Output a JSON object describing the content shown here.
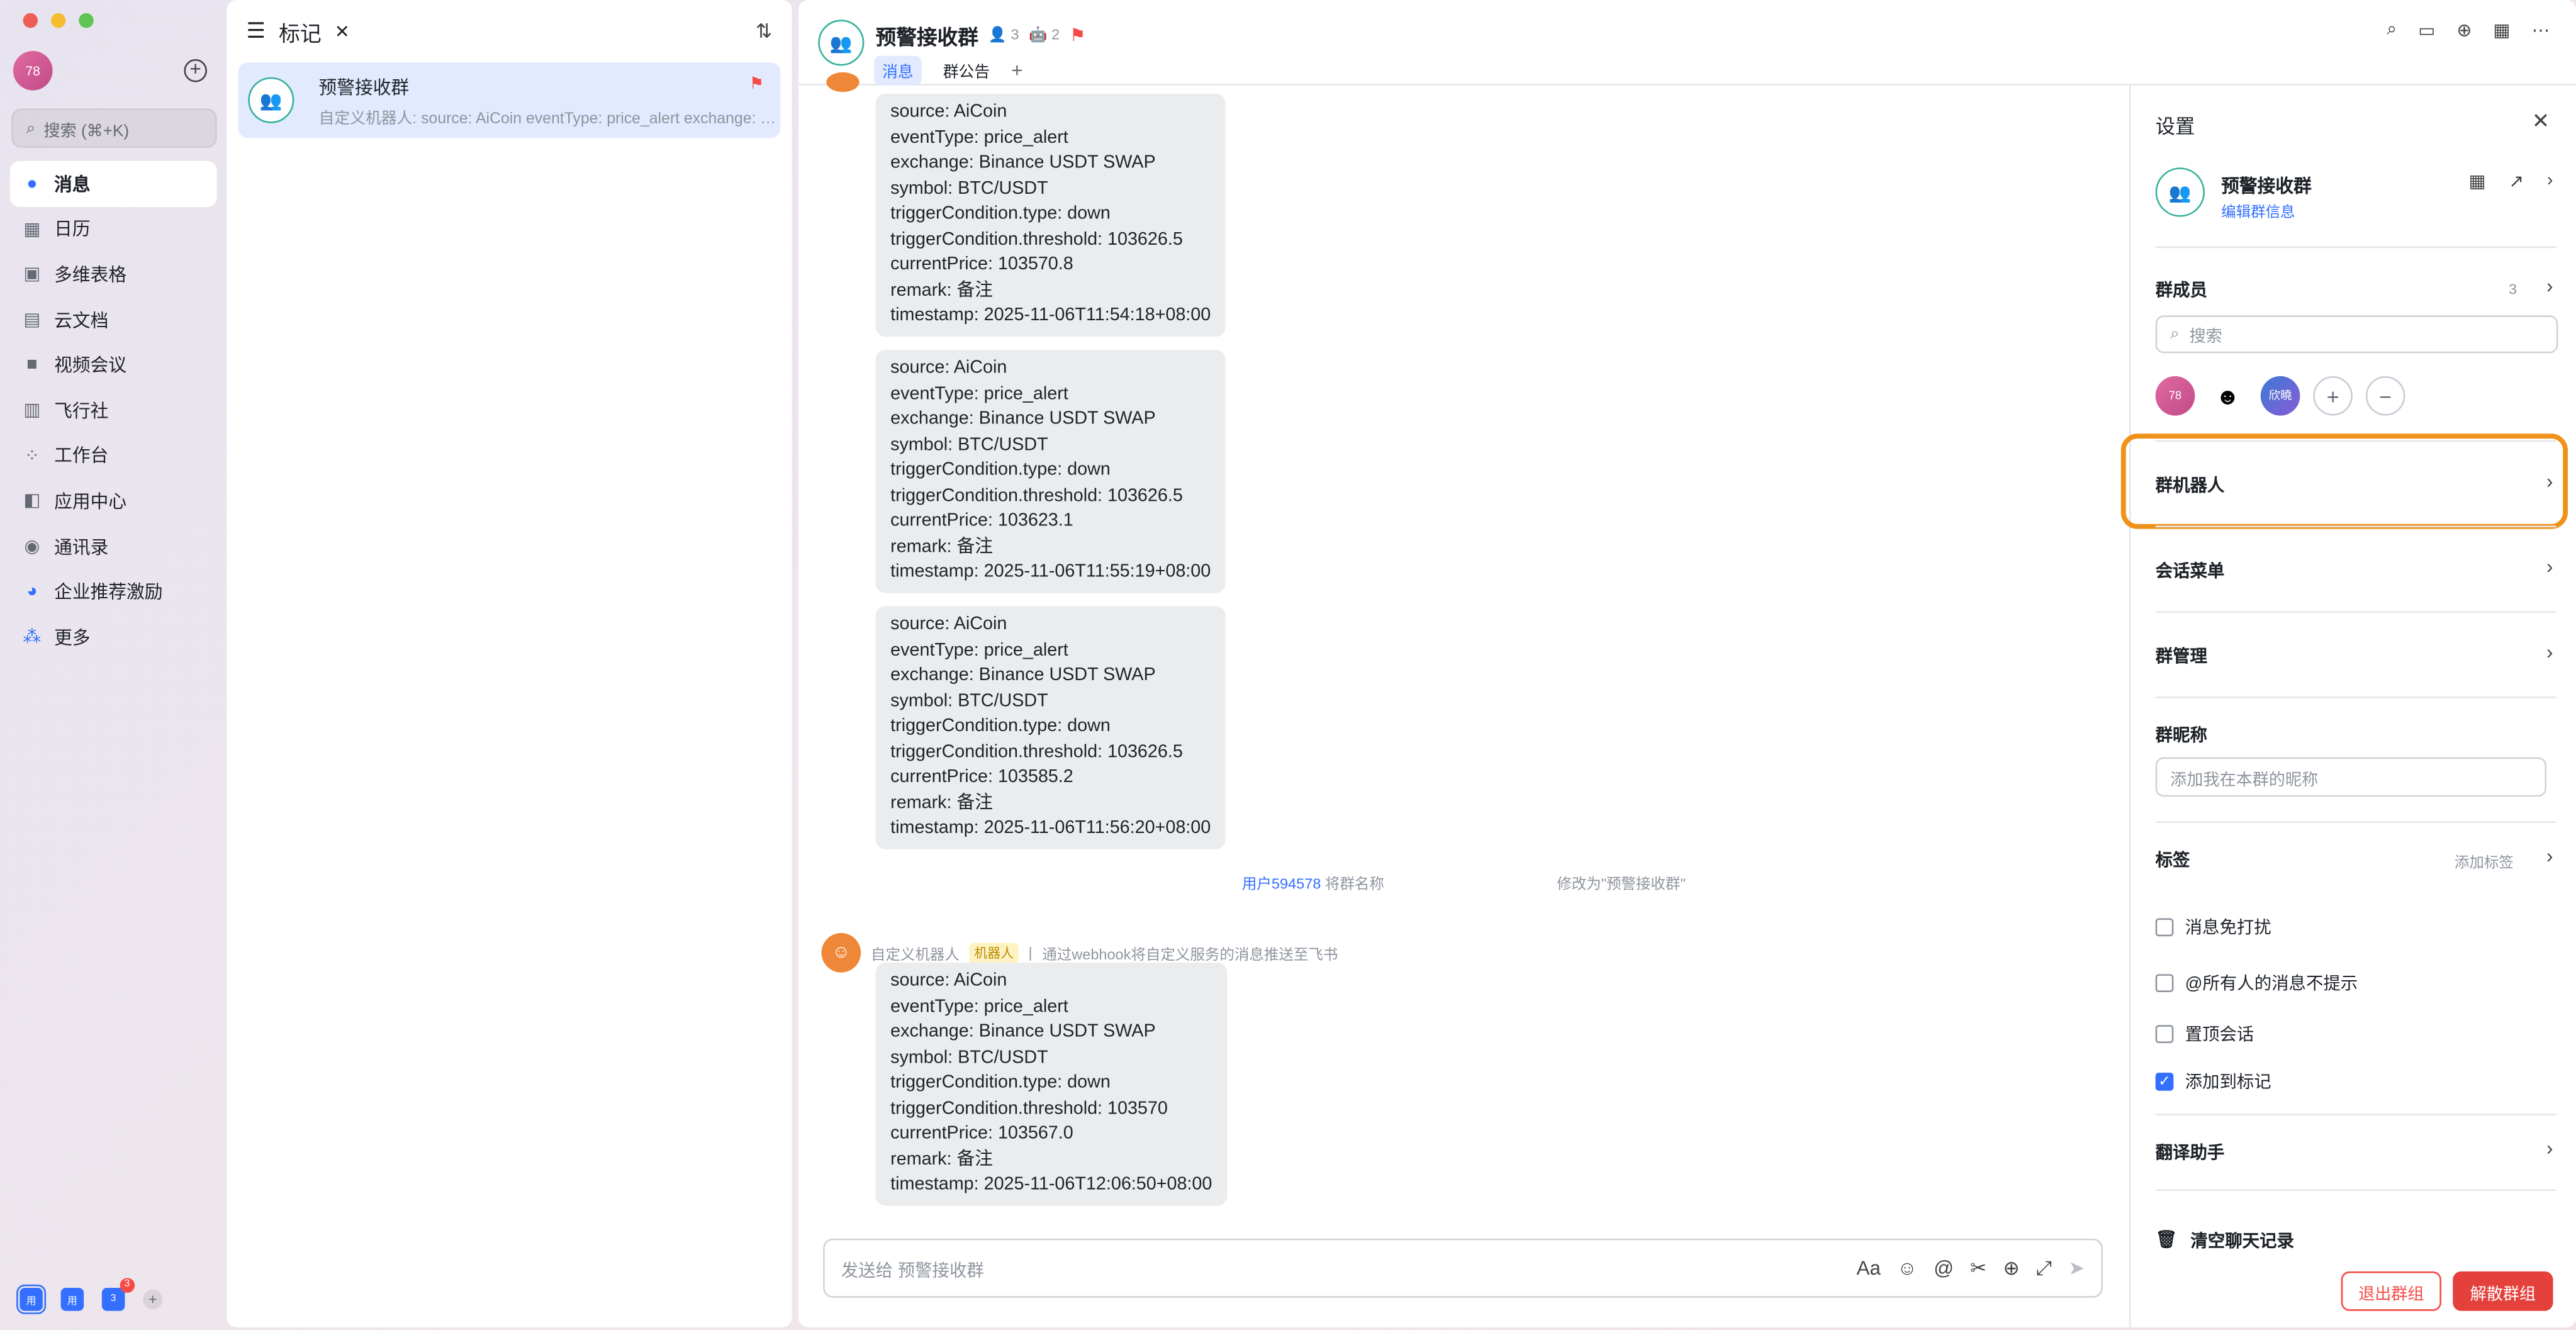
{
  "me": {
    "avatar_text": "78"
  },
  "search": {
    "placeholder": "搜索 (⌘+K)"
  },
  "nav": [
    {
      "label": "消息",
      "icon": "message-icon",
      "color": "#3370ff"
    },
    {
      "label": "日历",
      "icon": "calendar-icon",
      "color": "#646a73"
    },
    {
      "label": "多维表格",
      "icon": "base-icon",
      "color": "#646a73"
    },
    {
      "label": "云文档",
      "icon": "docs-icon",
      "color": "#646a73"
    },
    {
      "label": "视频会议",
      "icon": "video-icon",
      "color": "#646a73"
    },
    {
      "label": "飞行社",
      "icon": "book-icon",
      "color": "#646a73"
    },
    {
      "label": "工作台",
      "icon": "workplace-icon",
      "color": "#646a73"
    },
    {
      "label": "应用中心",
      "icon": "app-center-icon",
      "color": "#646a73"
    },
    {
      "label": "通讯录",
      "icon": "contacts-icon",
      "color": "#646a73"
    },
    {
      "label": "企业推荐激励",
      "icon": "referral-icon",
      "color": "#3370ff"
    },
    {
      "label": "更多",
      "icon": "more-apps-icon",
      "color": "#3370ff"
    }
  ],
  "bottom_apps": [
    {
      "label": "用"
    },
    {
      "label": "用"
    },
    {
      "label": "3",
      "badge": "3"
    }
  ],
  "list": {
    "title": "标记",
    "items": [
      {
        "name": "预警接收群",
        "preview": "自定义机器人: source: AiCoin eventType: price_alert exchange: Binance USDT SWAP symbol: BTC/USDT"
      }
    ]
  },
  "chat": {
    "title": "预警接收群",
    "member_count": "3",
    "bot_count": "2",
    "tabs": [
      "消息",
      "群公告"
    ],
    "messages": [
      "source: AiCoin\neventType: price_alert\nexchange: Binance USDT SWAP\nsymbol: BTC/USDT\ntriggerCondition.type: down\ntriggerCondition.threshold: 103626.5\ncurrentPrice: 103570.8\nremark: 备注\ntimestamp: 2025-11-06T11:54:18+08:00",
      "source: AiCoin\neventType: price_alert\nexchange: Binance USDT SWAP\nsymbol: BTC/USDT\ntriggerCondition.type: down\ntriggerCondition.threshold: 103626.5\ncurrentPrice: 103623.1\nremark: 备注\ntimestamp: 2025-11-06T11:55:19+08:00",
      "source: AiCoin\neventType: price_alert\nexchange: Binance USDT SWAP\nsymbol: BTC/USDT\ntriggerCondition.type: down\ntriggerCondition.threshold: 103626.5\ncurrentPrice: 103585.2\nremark: 备注\ntimestamp: 2025-11-06T11:56:20+08:00",
      "source: AiCoin\neventType: price_alert\nexchange: Binance USDT SWAP\nsymbol: BTC/USDT\ntriggerCondition.type: down\ntriggerCondition.threshold: 103570\ncurrentPrice: 103567.0\nremark: 备注\ntimestamp: 2025-11-06T12:06:50+08:00"
    ],
    "system_msg": {
      "user": "用户594578",
      "before": "将群名称",
      "after": "修改为\"预警接收群\""
    },
    "bot": {
      "name": "自定义机器人",
      "tag": "机器人",
      "desc": "通过webhook将自定义服务的消息推送至飞书"
    },
    "composer_placeholder": "发送给 预警接收群"
  },
  "settings": {
    "title": "设置",
    "group_name": "预警接收群",
    "edit_label": "编辑群信息",
    "members_label": "群成员",
    "members_count": "3",
    "member_search_placeholder": "搜索",
    "members": [
      "78",
      "",
      "欣曉"
    ],
    "bots_label": "群机器人",
    "menu_label": "会话菜单",
    "manage_label": "群管理",
    "nickname_label": "群昵称",
    "nickname_placeholder": "添加我在本群的昵称",
    "tags_label": "标签",
    "tags_add": "添加标签",
    "options": [
      {
        "label": "消息免打扰",
        "checked": false
      },
      {
        "label": "@所有人的消息不提示",
        "checked": false
      },
      {
        "label": "置顶会话",
        "checked": false
      },
      {
        "label": "添加到标记",
        "checked": true
      }
    ],
    "translate_label": "翻译助手",
    "clear_label": "清空聊天记录",
    "leave_label": "退出群组",
    "dissolve_label": "解散群组"
  }
}
